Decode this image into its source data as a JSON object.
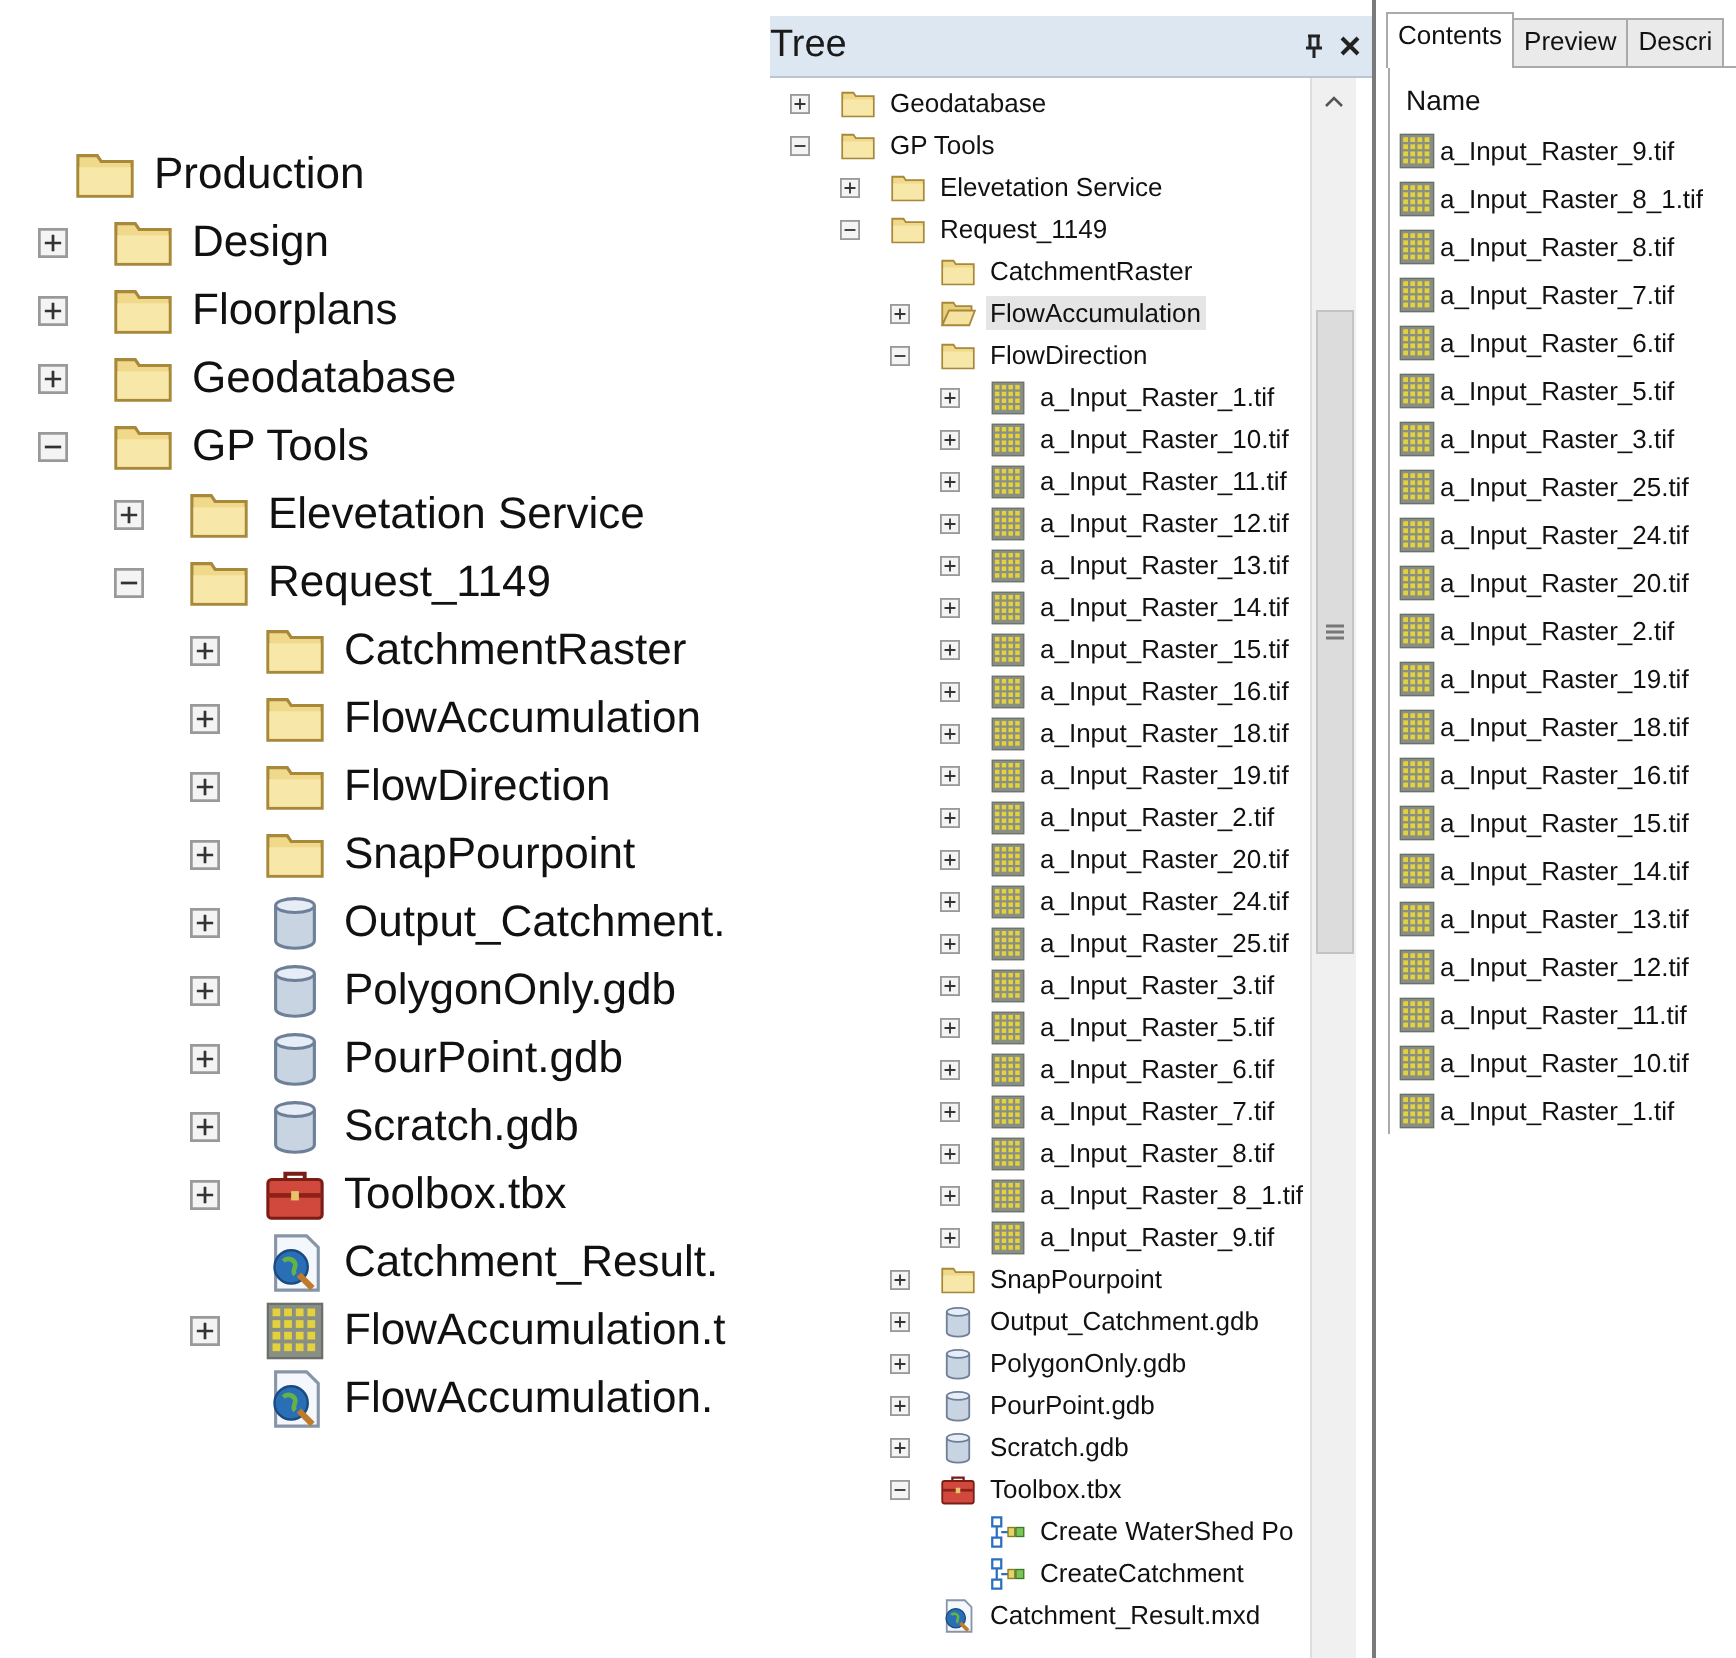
{
  "left_tree": [
    {
      "kind": "folder",
      "label": "Production",
      "children": [
        {
          "kind": "folder",
          "label": "Design",
          "expanded": false
        },
        {
          "kind": "folder",
          "label": "Floorplans",
          "expanded": false
        },
        {
          "kind": "folder",
          "label": "Geodatabase",
          "expanded": false
        },
        {
          "kind": "folder",
          "label": "GP Tools",
          "expanded": true,
          "children": [
            {
              "kind": "folder",
              "label": "Elevetation Service",
              "expanded": false
            },
            {
              "kind": "folder",
              "label": "Request_1149",
              "expanded": true,
              "children": [
                {
                  "kind": "folder",
                  "label": "CatchmentRaster",
                  "expanded": false
                },
                {
                  "kind": "folder",
                  "label": "FlowAccumulation",
                  "expanded": false
                },
                {
                  "kind": "folder",
                  "label": "FlowDirection",
                  "expanded": false
                },
                {
                  "kind": "folder",
                  "label": "SnapPourpoint",
                  "expanded": false
                },
                {
                  "kind": "database",
                  "label": "Output_Catchment.",
                  "expanded": false
                },
                {
                  "kind": "database",
                  "label": "PolygonOnly.gdb",
                  "expanded": false
                },
                {
                  "kind": "database",
                  "label": "PourPoint.gdb",
                  "expanded": false
                },
                {
                  "kind": "database",
                  "label": "Scratch.gdb",
                  "expanded": false
                },
                {
                  "kind": "toolbox",
                  "label": "Toolbox.tbx",
                  "expanded": false
                },
                {
                  "kind": "map",
                  "label": "Catchment_Result."
                },
                {
                  "kind": "raster",
                  "label": "FlowAccumulation.t",
                  "expanded": false
                },
                {
                  "kind": "map",
                  "label": "FlowAccumulation."
                }
              ]
            }
          ]
        }
      ]
    }
  ],
  "catalog": {
    "title": "Tree",
    "tree": [
      {
        "kind": "folder",
        "label": "Geodatabase",
        "expanded": false,
        "selected": false
      },
      {
        "kind": "folder",
        "label": "GP Tools",
        "expanded": true,
        "selected": false,
        "children": [
          {
            "kind": "folder",
            "label": "Elevetation Service",
            "expanded": false,
            "selected": false
          },
          {
            "kind": "folder",
            "label": "Request_1149",
            "expanded": true,
            "selected": false,
            "children": [
              {
                "kind": "folder",
                "label": "CatchmentRaster",
                "selected": false
              },
              {
                "kind": "folder",
                "label": "FlowAccumulation",
                "expanded": false,
                "selected": true
              },
              {
                "kind": "folder",
                "label": "FlowDirection",
                "expanded": true,
                "selected": false,
                "children": [
                  {
                    "kind": "raster",
                    "label": "a_Input_Raster_1.tif",
                    "expanded": false,
                    "selected": false
                  },
                  {
                    "kind": "raster",
                    "label": "a_Input_Raster_10.tif",
                    "expanded": false,
                    "selected": false
                  },
                  {
                    "kind": "raster",
                    "label": "a_Input_Raster_11.tif",
                    "expanded": false,
                    "selected": false
                  },
                  {
                    "kind": "raster",
                    "label": "a_Input_Raster_12.tif",
                    "expanded": false,
                    "selected": false
                  },
                  {
                    "kind": "raster",
                    "label": "a_Input_Raster_13.tif",
                    "expanded": false,
                    "selected": false
                  },
                  {
                    "kind": "raster",
                    "label": "a_Input_Raster_14.tif",
                    "expanded": false,
                    "selected": false
                  },
                  {
                    "kind": "raster",
                    "label": "a_Input_Raster_15.tif",
                    "expanded": false,
                    "selected": false
                  },
                  {
                    "kind": "raster",
                    "label": "a_Input_Raster_16.tif",
                    "expanded": false,
                    "selected": false
                  },
                  {
                    "kind": "raster",
                    "label": "a_Input_Raster_18.tif",
                    "expanded": false,
                    "selected": false
                  },
                  {
                    "kind": "raster",
                    "label": "a_Input_Raster_19.tif",
                    "expanded": false,
                    "selected": false
                  },
                  {
                    "kind": "raster",
                    "label": "a_Input_Raster_2.tif",
                    "expanded": false,
                    "selected": false
                  },
                  {
                    "kind": "raster",
                    "label": "a_Input_Raster_20.tif",
                    "expanded": false,
                    "selected": false
                  },
                  {
                    "kind": "raster",
                    "label": "a_Input_Raster_24.tif",
                    "expanded": false,
                    "selected": false
                  },
                  {
                    "kind": "raster",
                    "label": "a_Input_Raster_25.tif",
                    "expanded": false,
                    "selected": false
                  },
                  {
                    "kind": "raster",
                    "label": "a_Input_Raster_3.tif",
                    "expanded": false,
                    "selected": false
                  },
                  {
                    "kind": "raster",
                    "label": "a_Input_Raster_5.tif",
                    "expanded": false,
                    "selected": false
                  },
                  {
                    "kind": "raster",
                    "label": "a_Input_Raster_6.tif",
                    "expanded": false,
                    "selected": false
                  },
                  {
                    "kind": "raster",
                    "label": "a_Input_Raster_7.tif",
                    "expanded": false,
                    "selected": false
                  },
                  {
                    "kind": "raster",
                    "label": "a_Input_Raster_8.tif",
                    "expanded": false,
                    "selected": false
                  },
                  {
                    "kind": "raster",
                    "label": "a_Input_Raster_8_1.tif",
                    "expanded": false,
                    "selected": false
                  },
                  {
                    "kind": "raster",
                    "label": "a_Input_Raster_9.tif",
                    "expanded": false,
                    "selected": false
                  }
                ]
              },
              {
                "kind": "folder",
                "label": "SnapPourpoint",
                "expanded": false,
                "selected": false
              },
              {
                "kind": "database",
                "label": "Output_Catchment.gdb",
                "expanded": false,
                "selected": false
              },
              {
                "kind": "database",
                "label": "PolygonOnly.gdb",
                "expanded": false,
                "selected": false
              },
              {
                "kind": "database",
                "label": "PourPoint.gdb",
                "expanded": false,
                "selected": false
              },
              {
                "kind": "database",
                "label": "Scratch.gdb",
                "expanded": false,
                "selected": false
              },
              {
                "kind": "toolbox",
                "label": "Toolbox.tbx",
                "expanded": true,
                "selected": false,
                "children": [
                  {
                    "kind": "tool",
                    "label": "Create WaterShed Po",
                    "selected": false
                  },
                  {
                    "kind": "tool",
                    "label": "CreateCatchment",
                    "selected": false
                  }
                ]
              },
              {
                "kind": "map",
                "label": "Catchment_Result.mxd",
                "selected": false
              }
            ]
          }
        ]
      }
    ]
  },
  "contents": {
    "tabs": [
      {
        "label": "Contents",
        "selected": true
      },
      {
        "label": "Preview",
        "selected": false
      },
      {
        "label": "Descri",
        "selected": false
      }
    ],
    "column": "Name",
    "items": [
      {
        "kind": "raster",
        "label": "a_Input_Raster_9.tif"
      },
      {
        "kind": "raster",
        "label": "a_Input_Raster_8_1.tif"
      },
      {
        "kind": "raster",
        "label": "a_Input_Raster_8.tif"
      },
      {
        "kind": "raster",
        "label": "a_Input_Raster_7.tif"
      },
      {
        "kind": "raster",
        "label": "a_Input_Raster_6.tif"
      },
      {
        "kind": "raster",
        "label": "a_Input_Raster_5.tif"
      },
      {
        "kind": "raster",
        "label": "a_Input_Raster_3.tif"
      },
      {
        "kind": "raster",
        "label": "a_Input_Raster_25.tif"
      },
      {
        "kind": "raster",
        "label": "a_Input_Raster_24.tif"
      },
      {
        "kind": "raster",
        "label": "a_Input_Raster_20.tif"
      },
      {
        "kind": "raster",
        "label": "a_Input_Raster_2.tif"
      },
      {
        "kind": "raster",
        "label": "a_Input_Raster_19.tif"
      },
      {
        "kind": "raster",
        "label": "a_Input_Raster_18.tif"
      },
      {
        "kind": "raster",
        "label": "a_Input_Raster_16.tif"
      },
      {
        "kind": "raster",
        "label": "a_Input_Raster_15.tif"
      },
      {
        "kind": "raster",
        "label": "a_Input_Raster_14.tif"
      },
      {
        "kind": "raster",
        "label": "a_Input_Raster_13.tif"
      },
      {
        "kind": "raster",
        "label": "a_Input_Raster_12.tif"
      },
      {
        "kind": "raster",
        "label": "a_Input_Raster_11.tif"
      },
      {
        "kind": "raster",
        "label": "a_Input_Raster_10.tif"
      },
      {
        "kind": "raster",
        "label": "a_Input_Raster_1.tif"
      }
    ]
  }
}
